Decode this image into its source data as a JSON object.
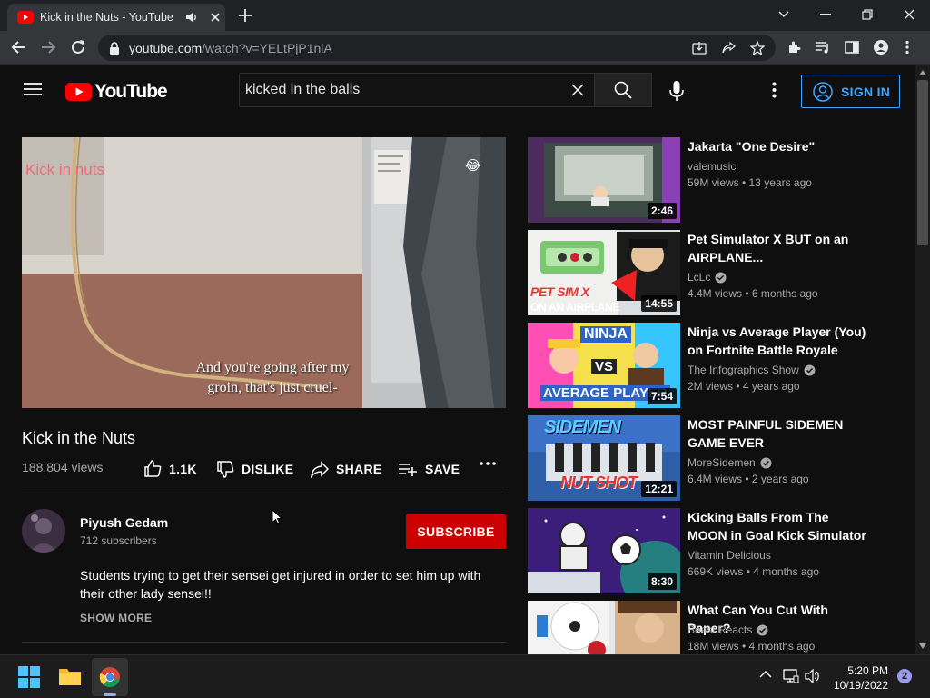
{
  "browser": {
    "tab_title": "Kick in the Nuts - YouTube",
    "url_host": "youtube.com",
    "url_path": "/watch?v=YELtPjP1niA"
  },
  "header": {
    "logo_text": "YouTube",
    "search_value": "kicked in the balls",
    "signin_label": "SIGN IN"
  },
  "video": {
    "overlay_text": "Kick in nuts",
    "caption_line1": "And you're going after my",
    "caption_line2": "groin, that's just cruel-",
    "title": "Kick in the Nuts",
    "views": "188,804 views",
    "likes": "1.1K",
    "dislike_label": "DISLIKE",
    "share_label": "SHARE",
    "save_label": "SAVE"
  },
  "channel": {
    "name": "Piyush Gedam",
    "subscribers": "712 subscribers",
    "subscribe_label": "SUBSCRIBE",
    "description": "Students trying to get their sensei get injured in order to set him up with their other lady sensei!!",
    "show_more": "SHOW MORE"
  },
  "recommendations": [
    {
      "title": "Jakarta \"One Desire\"",
      "channel": "valemusic",
      "verified": false,
      "meta": "59M views • 13 years ago",
      "duration": "2:46"
    },
    {
      "title": "Pet Simulator X BUT on an AIRPLANE...",
      "channel": "LcLc",
      "verified": true,
      "meta": "4.4M views • 6 months ago",
      "duration": "14:55",
      "thumb_text1": "PET SIM X",
      "thumb_text2": "ON AN AIRPLANE"
    },
    {
      "title": "Ninja vs Average Player (You) on Fortnite Battle Royale",
      "channel": "The Infographics Show",
      "verified": true,
      "meta": "2M views • 4 years ago",
      "duration": "7:54",
      "thumb_text1": "NINJA",
      "thumb_text2": "VS",
      "thumb_text3": "AVERAGE PLAYER"
    },
    {
      "title": "MOST PAINFUL SIDEMEN GAME EVER",
      "channel": "MoreSidemen",
      "verified": true,
      "meta": "6.4M views • 2 years ago",
      "duration": "12:21",
      "thumb_text1": "SIDEMEN",
      "thumb_text2": "NUT SHOT"
    },
    {
      "title": "Kicking Balls From The MOON in Goal Kick Simulator",
      "channel": "Vitamin Delicious",
      "verified": false,
      "meta": "669K views • 4 months ago",
      "duration": "8:30"
    },
    {
      "title": "What Can You Cut With Paper?",
      "channel": "Beast Reacts",
      "verified": true,
      "meta": "18M views • 4 months ago",
      "duration": ""
    }
  ],
  "taskbar": {
    "time": "5:20 PM",
    "date": "10/19/2022",
    "notification_count": "2"
  },
  "colors": {
    "accent_blue": "#3ea6ff",
    "subscribe_red": "#cc0000",
    "yt_red": "#ff0000"
  }
}
